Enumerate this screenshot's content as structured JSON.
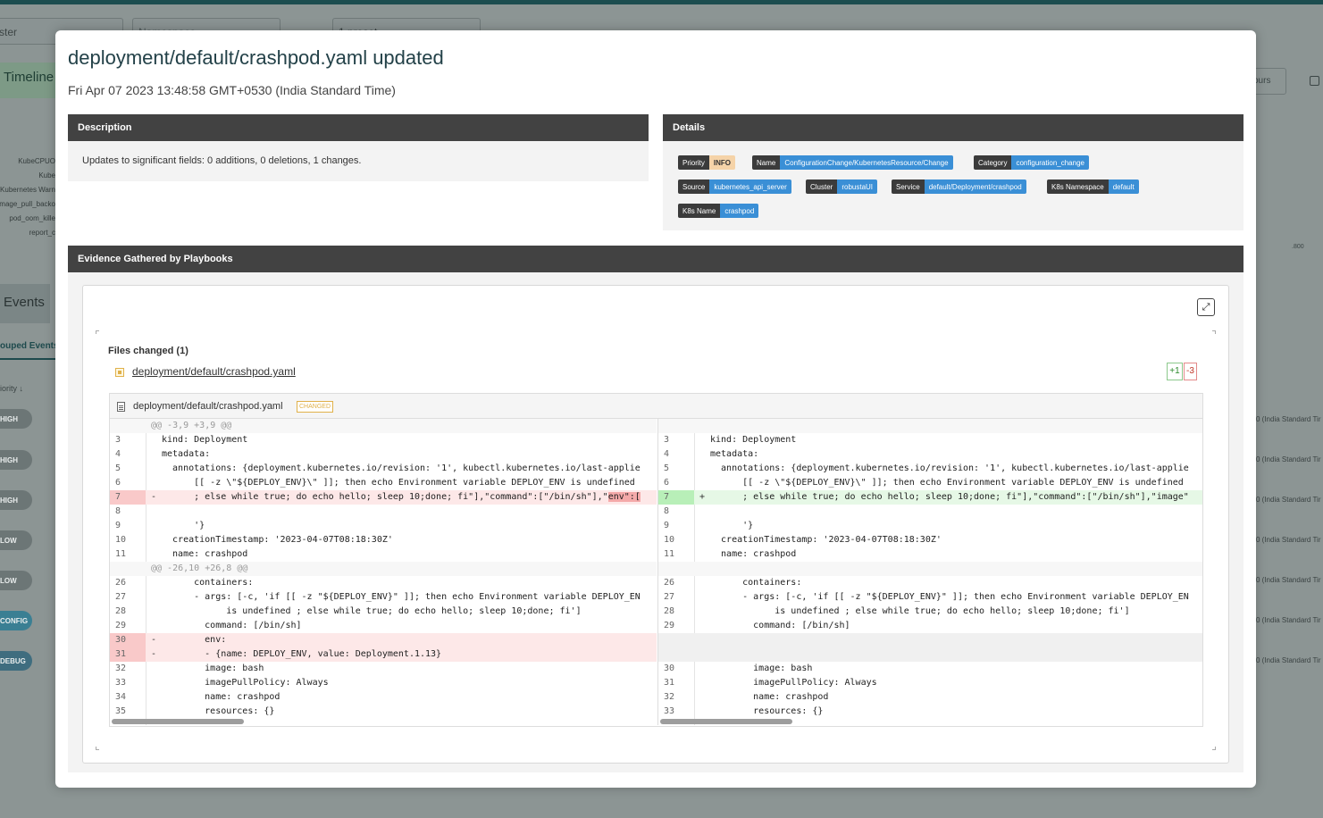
{
  "background": {
    "inputs": [
      "ster",
      "Namespace",
      "1 preset"
    ],
    "tabs": {
      "timeline": "Timeline",
      "events": "Events",
      "grouped_events": "ouped Events"
    },
    "chart_labels": [
      "KubeCPUO",
      "Kube",
      "Kubernetes Warn",
      "mage_pull_backo",
      "pod_oom_kille",
      "report_c"
    ],
    "sort_label": "iority",
    "hours_btn": "ours",
    "axis_tick": ".800",
    "priority_chips": [
      "HIGH",
      "HIGH",
      "HIGH",
      "LOW",
      "LOW",
      "CONFIG",
      "DEBUG"
    ],
    "right_dates": "0 (India Standard Tir"
  },
  "modal": {
    "title": "deployment/default/crashpod.yaml updated",
    "timestamp": "Fri Apr 07 2023 13:48:58 GMT+0530 (India Standard Time)",
    "description": {
      "header": "Description",
      "text": "Updates to significant fields: 0 additions, 0 deletions, 1 changes."
    },
    "details": {
      "header": "Details",
      "tags": [
        {
          "key": "Priority",
          "value": "INFO"
        },
        {
          "key": "Name",
          "value": "ConfigurationChange/KubernetesResource/Change"
        },
        {
          "key": "Category",
          "value": "configuration_change"
        },
        {
          "key": "Source",
          "value": "kubernetes_api_server"
        },
        {
          "key": "Cluster",
          "value": "robustaUI"
        },
        {
          "key": "Service",
          "value": "default/Deployment/crashpod"
        },
        {
          "key": "K8s Namespace",
          "value": "default"
        },
        {
          "key": "K8s Name",
          "value": "crashpod"
        }
      ]
    },
    "evidence": {
      "header": "Evidence Gathered by Playbooks",
      "expand_icon": "expand-icon",
      "files_changed": "Files changed (1)",
      "file_link": "deployment/default/crashpod.yaml",
      "additions": "+1",
      "deletions": "-3",
      "diff_filename": "deployment/default/crashpod.yaml",
      "changed_badge": "CHANGED"
    }
  },
  "diff": {
    "left": [
      {
        "t": "hunk",
        "ln": "",
        "mk": "",
        "code": "@@ -3,9 +3,9 @@"
      },
      {
        "t": "ctx",
        "ln": "3",
        "mk": "",
        "code": "kind: Deployment"
      },
      {
        "t": "ctx",
        "ln": "4",
        "mk": "",
        "code": "metadata:"
      },
      {
        "t": "ctx",
        "ln": "5",
        "mk": "",
        "code": "  annotations: {deployment.kubernetes.io/revision: '1', kubectl.kubernetes.io/last-applie"
      },
      {
        "t": "ctx",
        "ln": "6",
        "mk": "",
        "code": "      [[ -z \\\"${DEPLOY_ENV}\\\" ]]; then echo Environment variable DEPLOY_ENV is undefined"
      },
      {
        "t": "del",
        "ln": "7",
        "mk": "-",
        "code": "      ; else while true; do echo hello; sleep 10;done; fi\"],\"command\":[\"/bin/sh\"],\"",
        "hl": "env\":["
      },
      {
        "t": "ctx",
        "ln": "8",
        "mk": "",
        "code": ""
      },
      {
        "t": "ctx",
        "ln": "9",
        "mk": "",
        "code": "      '}"
      },
      {
        "t": "ctx",
        "ln": "10",
        "mk": "",
        "code": "  creationTimestamp: '2023-04-07T08:18:30Z'"
      },
      {
        "t": "ctx",
        "ln": "11",
        "mk": "",
        "code": "  name: crashpod"
      },
      {
        "t": "hunk",
        "ln": "",
        "mk": "",
        "code": "@@ -26,10 +26,8 @@"
      },
      {
        "t": "ctx",
        "ln": "26",
        "mk": "",
        "code": "      containers:"
      },
      {
        "t": "ctx",
        "ln": "27",
        "mk": "",
        "code": "      - args: [-c, 'if [[ -z \"${DEPLOY_ENV}\" ]]; then echo Environment variable DEPLOY_EN"
      },
      {
        "t": "ctx",
        "ln": "28",
        "mk": "",
        "code": "            is undefined ; else while true; do echo hello; sleep 10;done; fi']"
      },
      {
        "t": "ctx",
        "ln": "29",
        "mk": "",
        "code": "        command: [/bin/sh]"
      },
      {
        "t": "del",
        "ln": "30",
        "mk": "-",
        "code": "        env:"
      },
      {
        "t": "del",
        "ln": "31",
        "mk": "-",
        "code": "        - {name: DEPLOY_ENV, value: Deployment.1.13}"
      },
      {
        "t": "ctx",
        "ln": "32",
        "mk": "",
        "code": "        image: bash"
      },
      {
        "t": "ctx",
        "ln": "33",
        "mk": "",
        "code": "        imagePullPolicy: Always"
      },
      {
        "t": "ctx",
        "ln": "34",
        "mk": "",
        "code": "        name: crashpod"
      },
      {
        "t": "ctx",
        "ln": "35",
        "mk": "",
        "code": "        resources: {}"
      }
    ],
    "right": [
      {
        "t": "hunk",
        "ln": "",
        "mk": "",
        "code": ""
      },
      {
        "t": "ctx",
        "ln": "3",
        "mk": "",
        "code": "kind: Deployment"
      },
      {
        "t": "ctx",
        "ln": "4",
        "mk": "",
        "code": "metadata:"
      },
      {
        "t": "ctx",
        "ln": "5",
        "mk": "",
        "code": "  annotations: {deployment.kubernetes.io/revision: '1', kubectl.kubernetes.io/last-applie"
      },
      {
        "t": "ctx",
        "ln": "6",
        "mk": "",
        "code": "      [[ -z \\\"${DEPLOY_ENV}\\\" ]]; then echo Environment variable DEPLOY_ENV is undefined"
      },
      {
        "t": "add",
        "ln": "7",
        "mk": "+",
        "code": "      ; else while true; do echo hello; sleep 10;done; fi\"],\"command\":[\"/bin/sh\"],\"image\""
      },
      {
        "t": "ctx",
        "ln": "8",
        "mk": "",
        "code": ""
      },
      {
        "t": "ctx",
        "ln": "9",
        "mk": "",
        "code": "      '}"
      },
      {
        "t": "ctx",
        "ln": "10",
        "mk": "",
        "code": "  creationTimestamp: '2023-04-07T08:18:30Z'"
      },
      {
        "t": "ctx",
        "ln": "11",
        "mk": "",
        "code": "  name: crashpod"
      },
      {
        "t": "hunk",
        "ln": "",
        "mk": "",
        "code": ""
      },
      {
        "t": "ctx",
        "ln": "26",
        "mk": "",
        "code": "      containers:"
      },
      {
        "t": "ctx",
        "ln": "27",
        "mk": "",
        "code": "      - args: [-c, 'if [[ -z \"${DEPLOY_ENV}\" ]]; then echo Environment variable DEPLOY_EN"
      },
      {
        "t": "ctx",
        "ln": "28",
        "mk": "",
        "code": "            is undefined ; else while true; do echo hello; sleep 10;done; fi']"
      },
      {
        "t": "ctx",
        "ln": "29",
        "mk": "",
        "code": "        command: [/bin/sh]"
      },
      {
        "t": "empty",
        "ln": "",
        "mk": "",
        "code": ""
      },
      {
        "t": "empty",
        "ln": "",
        "mk": "",
        "code": ""
      },
      {
        "t": "ctx",
        "ln": "30",
        "mk": "",
        "code": "        image: bash"
      },
      {
        "t": "ctx",
        "ln": "31",
        "mk": "",
        "code": "        imagePullPolicy: Always"
      },
      {
        "t": "ctx",
        "ln": "32",
        "mk": "",
        "code": "        name: crashpod"
      },
      {
        "t": "ctx",
        "ln": "33",
        "mk": "",
        "code": "        resources: {}"
      }
    ]
  }
}
